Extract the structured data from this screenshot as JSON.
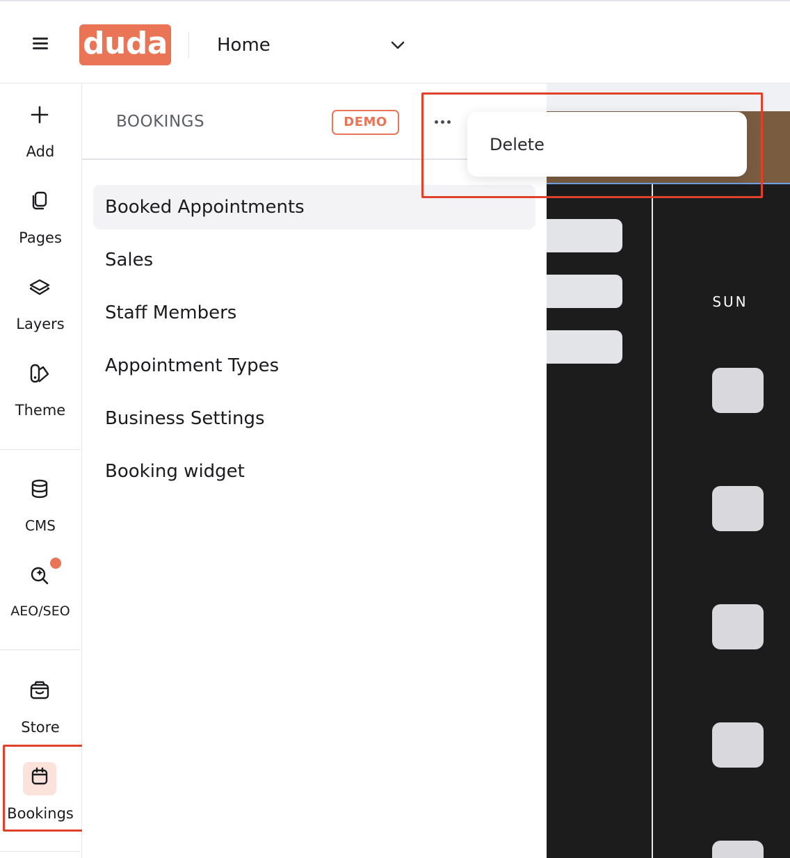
{
  "topbar": {
    "logo_text": "duda",
    "page_selector": "Home"
  },
  "rail": {
    "items": [
      {
        "label": "Add",
        "icon": "plus-icon"
      },
      {
        "label": "Pages",
        "icon": "pages-icon"
      },
      {
        "label": "Layers",
        "icon": "layers-icon"
      },
      {
        "label": "Theme",
        "icon": "theme-icon"
      },
      {
        "label": "CMS",
        "icon": "database-icon"
      },
      {
        "label": "AEO/SEO",
        "icon": "seo-search-icon"
      },
      {
        "label": "Store",
        "icon": "store-icon"
      },
      {
        "label": "Bookings",
        "icon": "calendar-icon"
      }
    ],
    "active": "Bookings"
  },
  "panel": {
    "title": "BOOKINGS",
    "badge": "DEMO",
    "menu": [
      "Booked Appointments",
      "Sales",
      "Staff Members",
      "Appointment Types",
      "Business Settings",
      "Booking widget"
    ],
    "active_item": "Booked Appointments"
  },
  "dropdown": {
    "items": [
      "Delete"
    ]
  },
  "preview": {
    "day_label": "SUN"
  },
  "colors": {
    "brand": "#e97456",
    "highlight": "#e0412b",
    "preview_bg": "#1c1c1c"
  }
}
